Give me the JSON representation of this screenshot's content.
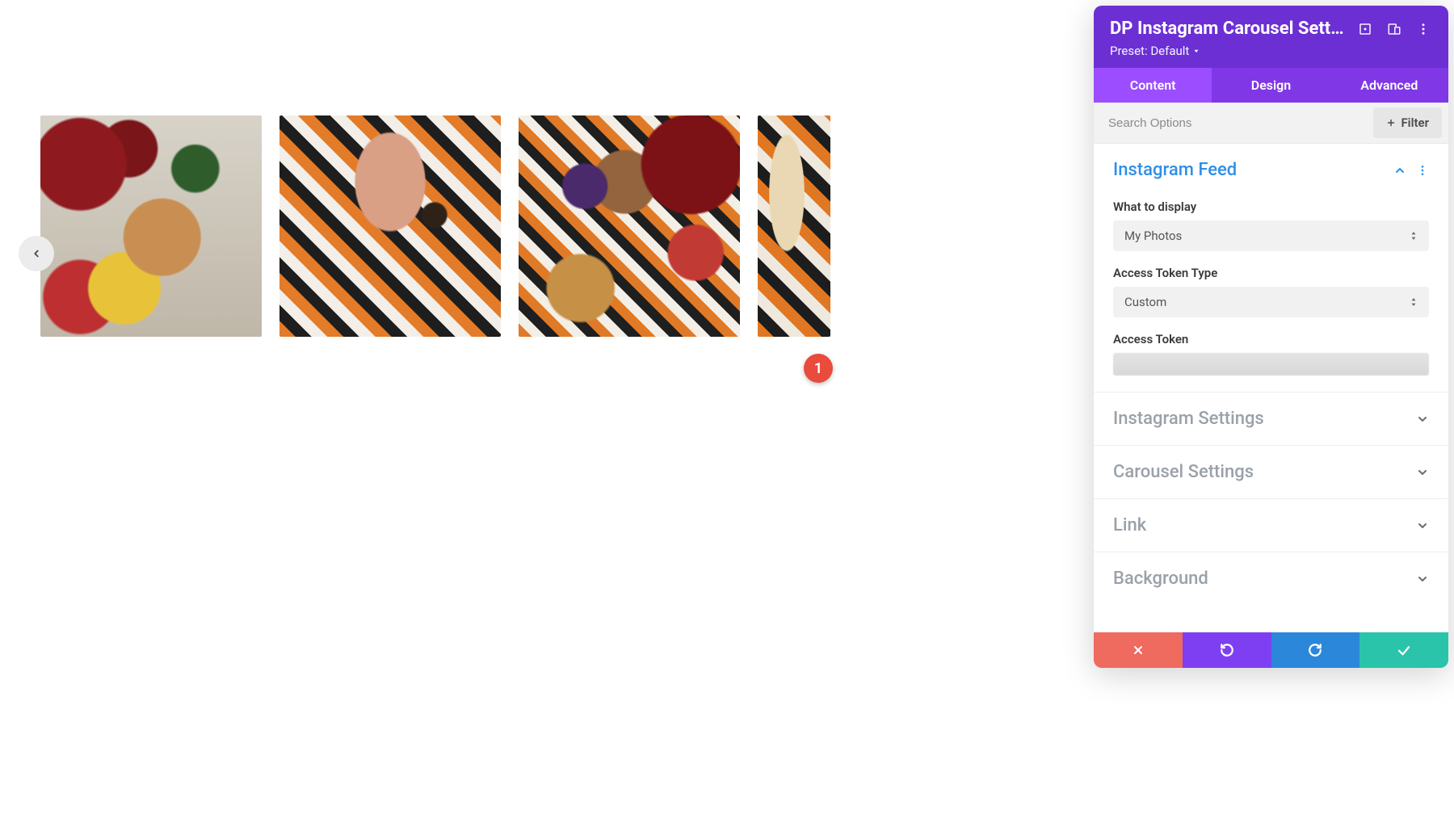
{
  "callouts": {
    "one": "1"
  },
  "panel": {
    "title": "DP Instagram Carousel Sett...",
    "preset_label": "Preset: Default",
    "tabs": {
      "content": "Content",
      "design": "Design",
      "advanced": "Advanced",
      "active": "content"
    },
    "search_placeholder": "Search Options",
    "filter_label": "Filter"
  },
  "sections": {
    "instagram_feed": {
      "title": "Instagram Feed",
      "fields": {
        "what_to_display": {
          "label": "What to display",
          "value": "My Photos"
        },
        "access_token_type": {
          "label": "Access Token Type",
          "value": "Custom"
        },
        "access_token": {
          "label": "Access Token",
          "value": ""
        }
      }
    },
    "instagram_settings": {
      "title": "Instagram Settings"
    },
    "carousel_settings": {
      "title": "Carousel Settings"
    },
    "link": {
      "title": "Link"
    },
    "background": {
      "title": "Background"
    }
  }
}
